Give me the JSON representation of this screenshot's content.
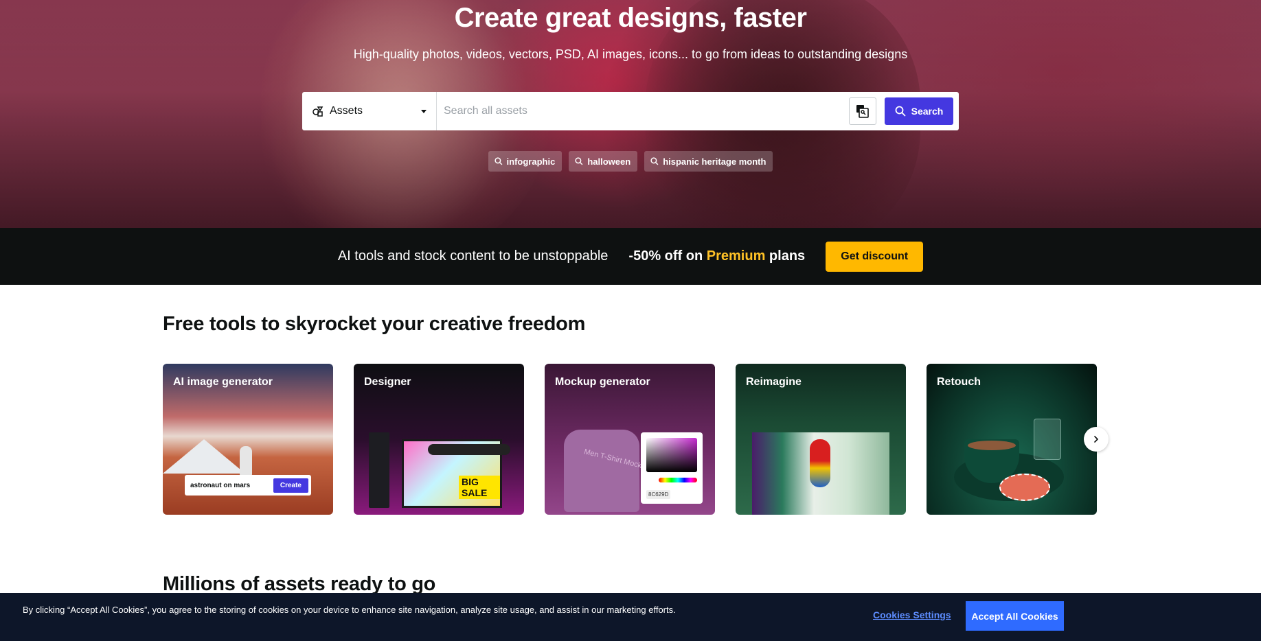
{
  "hero": {
    "title": "Create great designs, faster",
    "subtitle": "High-quality photos, videos, vectors, PSD, AI images, icons... to go from ideas to outstanding designs"
  },
  "search": {
    "category": "Assets",
    "placeholder": "Search all assets",
    "value": "",
    "button_label": "Search",
    "image_search_icon": "image-search-icon"
  },
  "tags": [
    "infographic",
    "halloween",
    "hispanic heritage month"
  ],
  "promo": {
    "text": "AI tools and stock content to be unstoppable",
    "deal_prefix": "-50% off on",
    "deal_highlight": "Premium",
    "deal_suffix": "plans",
    "button_label": "Get discount",
    "highlight_color": "#ffc226"
  },
  "tools": {
    "title": "Free tools to skyrocket your creative freedom",
    "cards": [
      {
        "label": "AI image generator",
        "prompt": "astronaut on mars",
        "prompt_button": "Create"
      },
      {
        "label": "Designer",
        "canvas_text": "BIG SALE"
      },
      {
        "label": "Mockup generator",
        "shirt_text": "Men T-Shirt Mockup",
        "hex": "8C629D"
      },
      {
        "label": "Reimagine"
      },
      {
        "label": "Retouch"
      }
    ]
  },
  "millions": {
    "title": "Millions of assets ready to go"
  },
  "cookie": {
    "text": "By clicking “Accept All Cookies”, you agree to the storing of cookies on your device to enhance site navigation, analyze site usage, and assist in our marketing efforts.",
    "settings_label": "Cookies Settings",
    "accept_label": "Accept All Cookies"
  },
  "colors": {
    "brand_blue": "#4438e0",
    "promo_yellow": "#ffb800",
    "cookie_bg": "#0d1629",
    "cookie_accept": "#2f6bff"
  }
}
